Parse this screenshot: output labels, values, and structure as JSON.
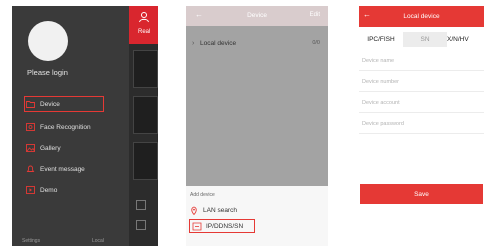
{
  "drawer": {
    "login_text": "Please login",
    "right_tab_label": "Real",
    "items": [
      {
        "label": "Device",
        "icon": "folder-icon",
        "active": true
      },
      {
        "label": "Face Recognition",
        "icon": "face-scan-icon",
        "active": false
      },
      {
        "label": "Gallery",
        "icon": "image-icon",
        "active": false
      },
      {
        "label": "Event message",
        "icon": "bell-icon",
        "active": false
      },
      {
        "label": "Demo",
        "icon": "play-icon",
        "active": false
      }
    ],
    "footer_left": "Settings",
    "footer_right": "Local"
  },
  "device_screen": {
    "title": "Device",
    "edit_label": "Edit",
    "group_label": "Local device",
    "group_count": "0/0",
    "add_device_label": "Add device",
    "options": [
      {
        "label": "LAN search",
        "icon": "location-pin-icon",
        "selected": false
      },
      {
        "label": "IP/DDNS/SN",
        "icon": "ip-icon",
        "selected": true
      }
    ]
  },
  "local_device": {
    "title": "Local device",
    "tabs": [
      "IPC/FISH",
      "SN",
      "X/N/HV"
    ],
    "fields": [
      {
        "placeholder": "Device name"
      },
      {
        "placeholder": "Device number"
      },
      {
        "placeholder": "Device account"
      },
      {
        "placeholder": "Device password"
      }
    ],
    "save_label": "Save"
  },
  "colors": {
    "accent": "#e53935",
    "drawer_bg": "#3a3a3a",
    "device_header": "#d9cccd",
    "device_overlay": "#a3a3a3"
  }
}
